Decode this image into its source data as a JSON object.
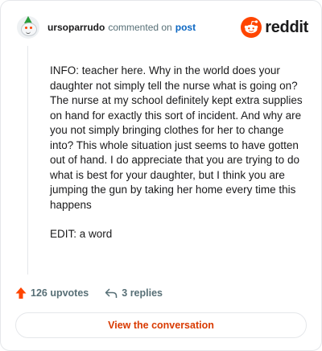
{
  "header": {
    "username": "ursoparrudo",
    "action": "commented on",
    "target": "post",
    "brand": "reddit",
    "colors": {
      "brand": "#ff4500",
      "link": "#0a66c2"
    },
    "avatar_icon": "snoo-avatar-icon",
    "brand_icon": "reddit-logo-icon"
  },
  "comment": {
    "paragraphs": [
      "INFO: teacher here. Why in the world does your daughter not simply tell the nurse what is going on? The nurse at my school definitely kept extra supplies on hand for exactly this sort of incident. And why are you not simply bringing clothes for her to change into? This whole situation just seems to have gotten out of hand. I do appreciate that you are trying to do what is best for your daughter, but I think you are jumping the gun by taking her home every time this happens",
      "EDIT: a word"
    ]
  },
  "actions": {
    "upvotes": "126 upvotes",
    "replies": "3 replies",
    "upvote_icon": "upvote-arrow-icon",
    "reply_icon": "reply-arrow-icon",
    "colors": {
      "upvote": "#ff4500",
      "muted": "#576f76"
    }
  },
  "cta": {
    "label": "View the conversation",
    "color": "#d93a00"
  }
}
